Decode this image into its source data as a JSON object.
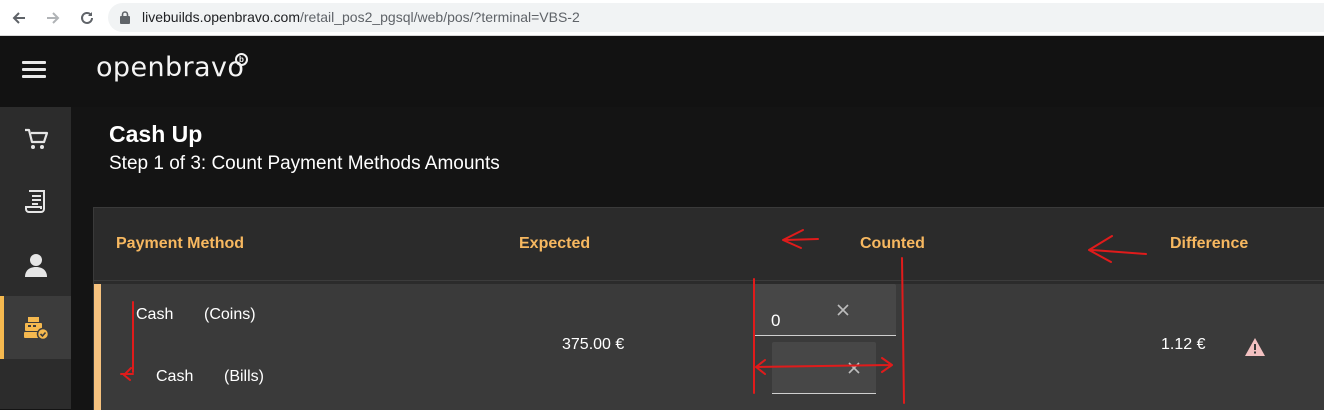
{
  "browser": {
    "url_host": "livebuilds.openbravo.com",
    "url_path": "/retail_pos2_pgsql/web/pos/?terminal=VBS-2"
  },
  "app": {
    "logo_text": "openbravo",
    "logo_badge": "b"
  },
  "sidebar": {
    "items": [
      {
        "icon": "cart-icon"
      },
      {
        "icon": "receipt-icon"
      },
      {
        "icon": "user-icon"
      },
      {
        "icon": "cashup-icon",
        "active": true
      }
    ]
  },
  "page": {
    "title": "Cash Up",
    "subtitle": "Step 1 of 3: Count Payment Methods Amounts"
  },
  "table": {
    "headers": {
      "payment_method": "Payment Method",
      "expected": "Expected",
      "counted": "Counted",
      "difference": "Difference"
    },
    "row": {
      "methods": [
        {
          "name": "Cash",
          "type": "(Coins)",
          "counted": "0"
        },
        {
          "name": "Cash",
          "type": "(Bills)",
          "counted": ""
        }
      ],
      "expected": "375.00 €",
      "difference": "1.12 €"
    }
  },
  "colors": {
    "accent": "#f7b860",
    "annotation": "#e01b1b",
    "warning_icon": "#f3c1c1"
  }
}
